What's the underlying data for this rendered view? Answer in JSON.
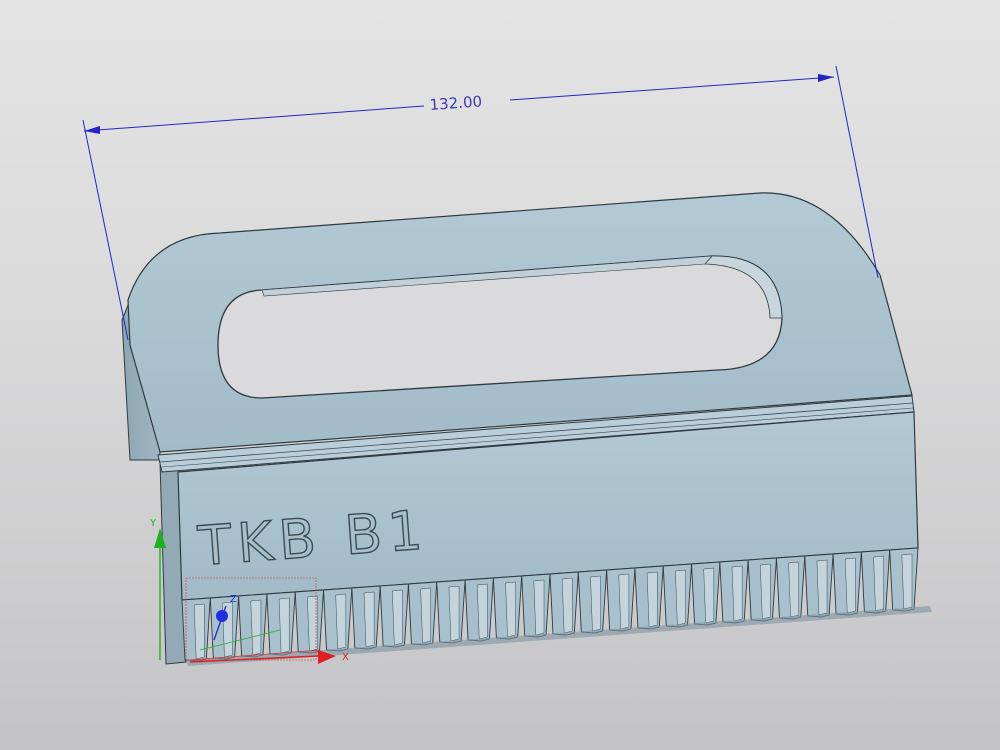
{
  "dimension": {
    "value": "132.00"
  },
  "part": {
    "engraving": "TKB B1"
  },
  "triad": {
    "x_label": "X",
    "y_label": "Y",
    "z_label": "Z"
  },
  "colors": {
    "part_face": "#a9c1cd",
    "part_edge": "#2e3a40",
    "dimension": "#2424c8",
    "axis_x": "#e02020",
    "axis_y": "#20b020",
    "axis_z": "#2030e0"
  }
}
